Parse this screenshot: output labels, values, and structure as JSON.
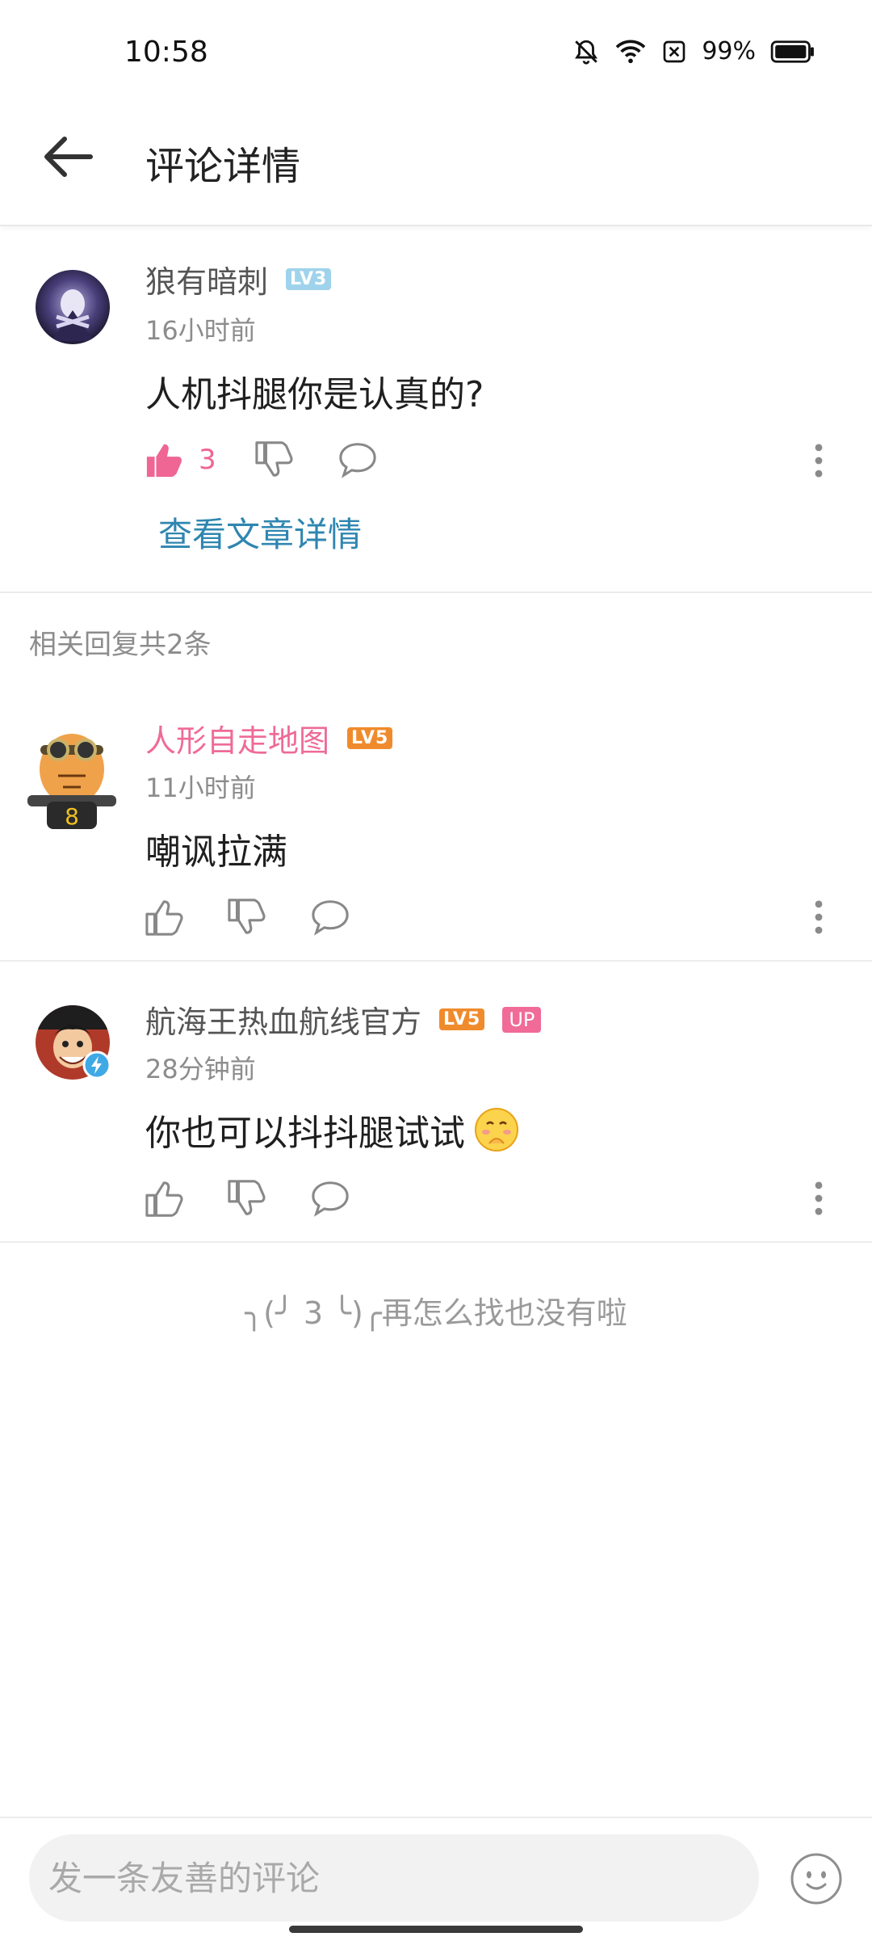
{
  "status_bar": {
    "time": "10:58",
    "battery": "99%"
  },
  "header": {
    "title": "评论详情"
  },
  "main_comment": {
    "username": "狼有暗刺",
    "level": "LV3",
    "time": "16小时前",
    "content": "人机抖腿你是认真的?",
    "like_count": "3",
    "view_article": "查看文章详情"
  },
  "replies_header": "相关回复共2条",
  "replies": [
    {
      "username": "人形自走地图",
      "level": "LV5",
      "time": "11小时前",
      "content": "嘲讽拉满"
    },
    {
      "username": "航海王热血航线官方",
      "level": "LV5",
      "badge": "UP",
      "time": "28分钟前",
      "content": "你也可以抖抖腿试试"
    }
  ],
  "end_message": "╮(╯ 3 ╰)╭再怎么找也没有啦",
  "input": {
    "placeholder": "发一条友善的评论"
  },
  "colors": {
    "accent_pink": "#ef6593",
    "link_blue": "#2f86b0",
    "lv3": "#9fd3ec",
    "lv5": "#f08b2d"
  },
  "icons": [
    "silent-bell-icon",
    "wifi-icon",
    "sim-off-icon",
    "battery-icon",
    "back-arrow-icon",
    "thumb-up-icon",
    "thumb-down-icon",
    "comment-bubble-icon",
    "more-vertical-icon",
    "emoji-icon"
  ]
}
